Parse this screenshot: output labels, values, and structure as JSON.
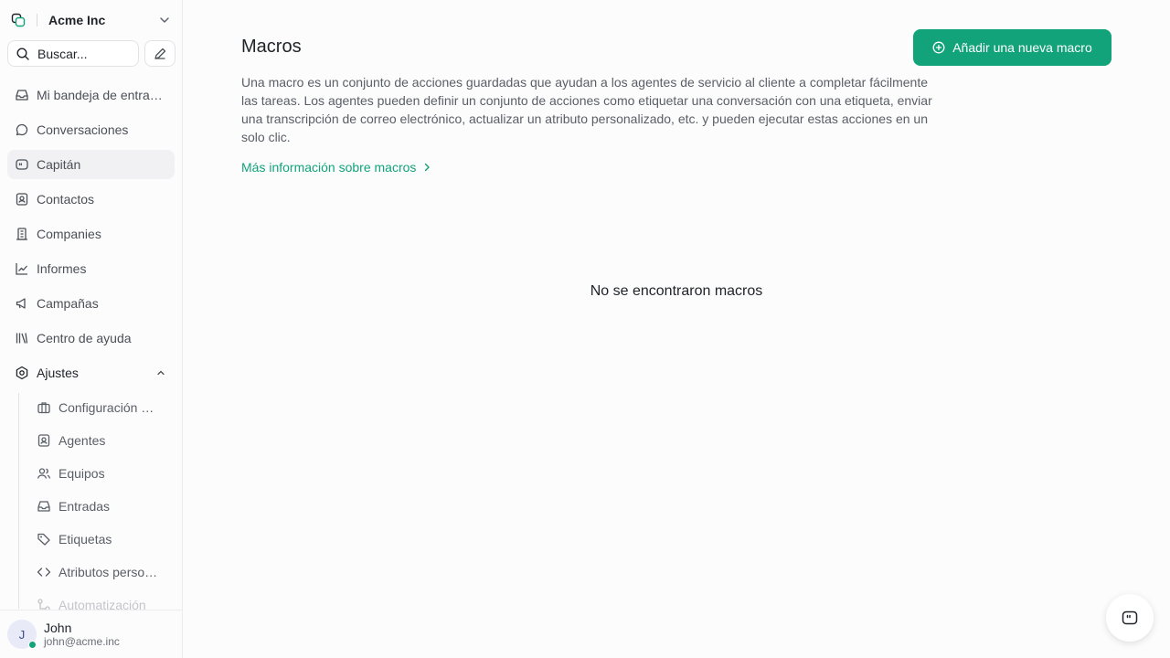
{
  "workspace": {
    "name": "Acme Inc"
  },
  "search": {
    "placeholder": "Buscar..."
  },
  "sidebar": {
    "items": [
      {
        "label": "Mi bandeja de entrada"
      },
      {
        "label": "Conversaciones"
      },
      {
        "label": "Capitán"
      },
      {
        "label": "Contactos"
      },
      {
        "label": "Companies"
      },
      {
        "label": "Informes"
      },
      {
        "label": "Campañas"
      },
      {
        "label": "Centro de ayuda"
      },
      {
        "label": "Ajustes"
      }
    ],
    "settings": [
      {
        "label": "Configuración de la cuenta"
      },
      {
        "label": "Agentes"
      },
      {
        "label": "Equipos"
      },
      {
        "label": "Entradas"
      },
      {
        "label": "Etiquetas"
      },
      {
        "label": "Atributos personalizados"
      },
      {
        "label": "Automatización"
      }
    ]
  },
  "user": {
    "initial": "J",
    "name": "John",
    "email": "john@acme.inc"
  },
  "main": {
    "title": "Macros",
    "description": "Una macro es un conjunto de acciones guardadas que ayudan a los agentes de servicio al cliente a completar fácilmente las tareas. Los agentes pueden definir un conjunto de acciones como etiquetar una conversación con una etiqueta, enviar una transcripción de correo electrónico, actualizar un atributo personalizado, etc. y pueden ejecutar estas acciones en un solo clic.",
    "learn_more": "Más información sobre macros",
    "add_button": "Añadir una nueva macro",
    "empty_state": "No se encontraron macros"
  },
  "colors": {
    "accent": "#13a37a",
    "online": "#12a37a"
  }
}
